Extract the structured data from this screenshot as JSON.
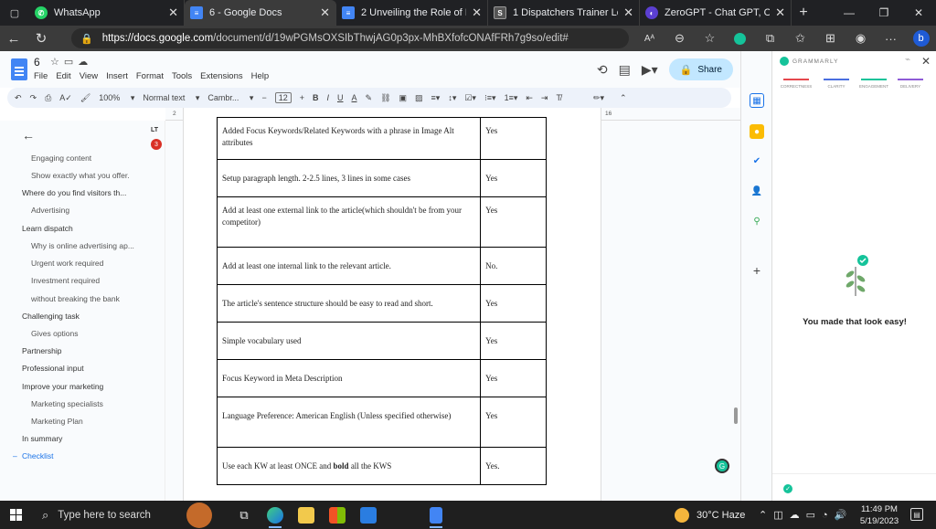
{
  "browser": {
    "tabs": [
      {
        "title": "WhatsApp",
        "fav_color": "#25d366",
        "icon": "whatsapp-icon"
      },
      {
        "title": "6 - Google Docs",
        "fav_color": "#4285f4",
        "icon": "docs-icon"
      },
      {
        "title": "2 Unveiling the Role of Indep",
        "fav_color": "#4285f4",
        "icon": "docs-icon"
      },
      {
        "title": "1 Dispatchers Trainer Location",
        "fav_color": "#555555",
        "icon": "page-icon"
      },
      {
        "title": "ZeroGPT - Chat GPT, Open AI",
        "fav_color": "#5b3fd1",
        "icon": "zerogpt-icon"
      }
    ],
    "url_host": "https://docs.google.com",
    "url_path": "/document/d/19wPGMsOXSIbThwjAG0p3px-MhBXfofcONAfFRh7g9so/edit#"
  },
  "docs": {
    "title": "6",
    "menu": [
      "File",
      "Edit",
      "View",
      "Insert",
      "Format",
      "Tools",
      "Extensions",
      "Help"
    ],
    "share_label": "Share",
    "avatar_letter": "F",
    "toolbar": {
      "zoom": "100%",
      "style": "Normal text",
      "font": "Cambr...",
      "font_size": "12"
    },
    "ruler_ticks": [
      "2",
      "1",
      "1",
      "2",
      "3",
      "4",
      "5",
      "6",
      "7",
      "8",
      "9",
      "10",
      "11",
      "12",
      "13",
      "14",
      "15",
      "16",
      "17",
      "18"
    ],
    "lt_badge": "LT",
    "lt_count": "3"
  },
  "outline": [
    {
      "label": "Engaging content",
      "level": 2
    },
    {
      "label": "Show exactly what you offer.",
      "level": 2
    },
    {
      "label": "Where do you find visitors th...",
      "level": 1
    },
    {
      "label": "Advertising",
      "level": 2
    },
    {
      "label": "Learn dispatch",
      "level": 1
    },
    {
      "label": "Why is online advertising ap...",
      "level": 2
    },
    {
      "label": "Urgent work required",
      "level": 2
    },
    {
      "label": "Investment required",
      "level": 2
    },
    {
      "label": "without breaking the bank",
      "level": 2
    },
    {
      "label": "Challenging task",
      "level": 1
    },
    {
      "label": "Gives options",
      "level": 2
    },
    {
      "label": "Partnership",
      "level": 1
    },
    {
      "label": "Professional input",
      "level": 1
    },
    {
      "label": "Improve your marketing",
      "level": 1
    },
    {
      "label": "Marketing specialists",
      "level": 2
    },
    {
      "label": "Marketing Plan",
      "level": 2
    },
    {
      "label": "In summary",
      "level": 1
    },
    {
      "label": "Checklist",
      "level": 1,
      "selected": true
    }
  ],
  "table_rows": [
    {
      "task": "Added Focus Keywords/Related Keywords with a phrase in Image Alt attributes",
      "status": "Yes"
    },
    {
      "task": "Setup paragraph length. 2-2.5 lines, 3 lines in some cases",
      "status": "Yes"
    },
    {
      "task": "Add at least one external link to the article(which shouldn't be from your competitor)",
      "status": "Yes"
    },
    {
      "task": "Add at least one internal link to the relevant article.",
      "status": "No."
    },
    {
      "task": "The article's sentence structure should be easy to read and short.",
      "status": "Yes"
    },
    {
      "task": "Simple vocabulary used",
      "status": "Yes"
    },
    {
      "task": "Focus Keyword in Meta Description",
      "status": "Yes"
    },
    {
      "task": "Language Preference: American English (Unless specified otherwise)",
      "status": "Yes"
    },
    {
      "task_pre": "Use each KW at least ONCE and ",
      "task_bold": "bold",
      "task_post": " all the KWS",
      "status": "Yes."
    }
  ],
  "grammarly": {
    "brand": "GRAMMARLY",
    "categories": [
      {
        "label": "CORRECTNESS",
        "color": "#e5484d"
      },
      {
        "label": "CLARITY",
        "color": "#4a6ee0"
      },
      {
        "label": "ENGAGEMENT",
        "color": "#15c39a"
      },
      {
        "label": "DELIVERY",
        "color": "#8e5bd6"
      }
    ],
    "message": "You made that look easy!"
  },
  "taskbar": {
    "search_placeholder": "Type here to search",
    "weather": "30°C  Haze",
    "time": "11:49 PM",
    "date": "5/19/2023"
  }
}
